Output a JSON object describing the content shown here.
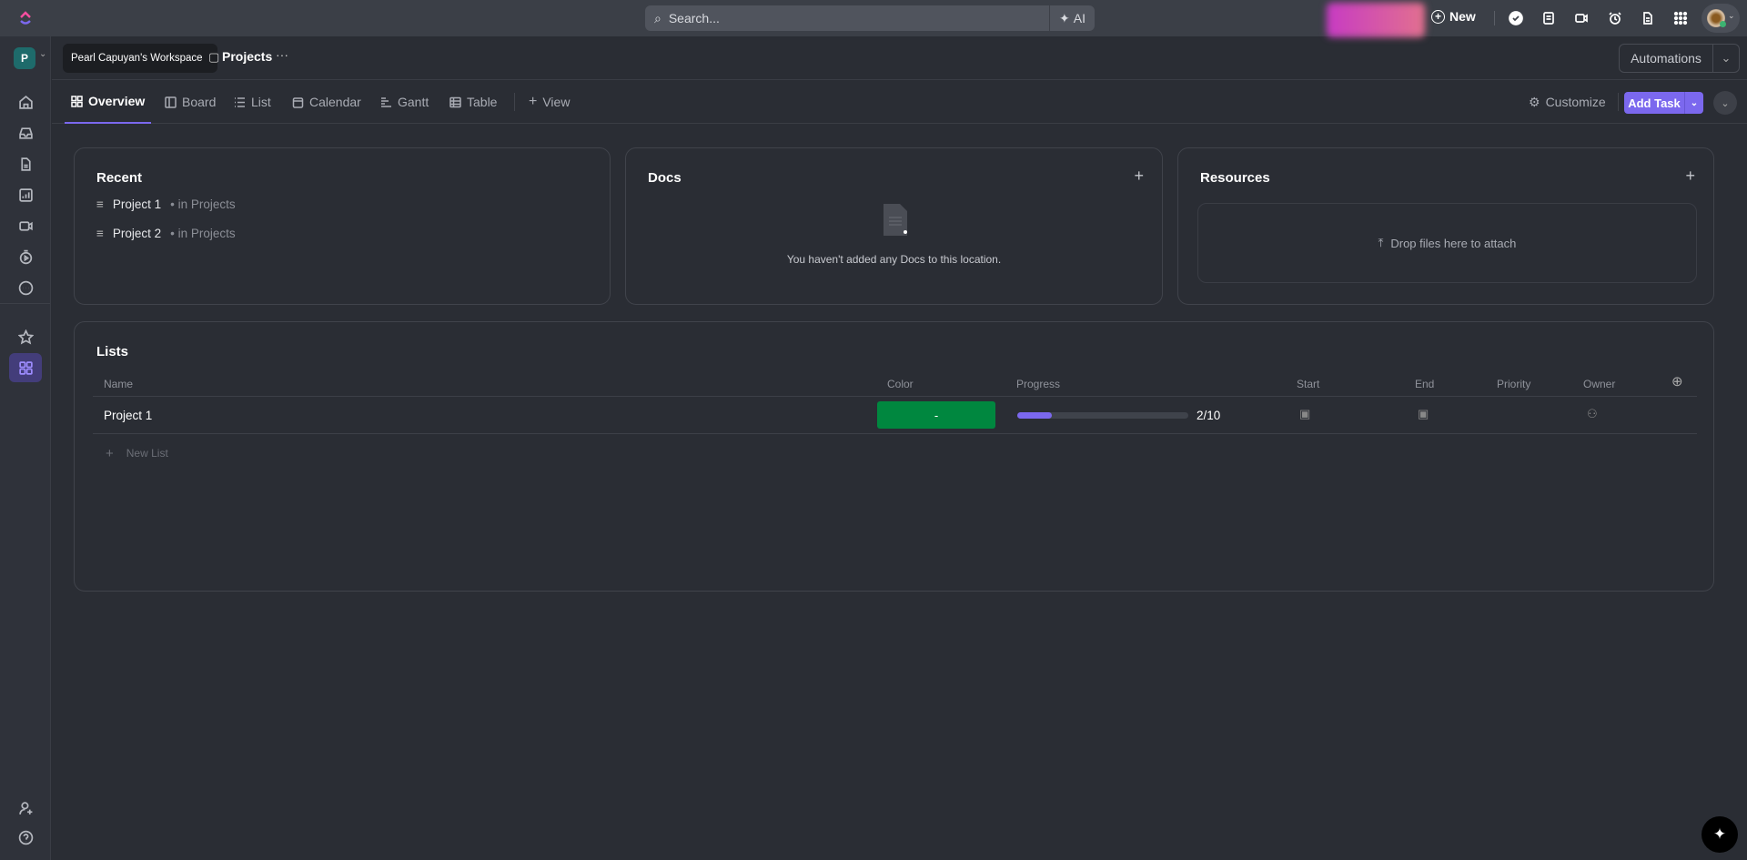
{
  "topbar": {
    "search_placeholder": "Search...",
    "ai_label": "AI",
    "new_label": "New"
  },
  "header": {
    "workspace_initial": "P",
    "tooltip": "Pearl Capuyan's Workspace",
    "breadcrumb_current": "Projects",
    "more": "···",
    "automations_label": "Automations"
  },
  "tabs": [
    {
      "label": "Overview"
    },
    {
      "label": "Board"
    },
    {
      "label": "List"
    },
    {
      "label": "Calendar"
    },
    {
      "label": "Gantt"
    },
    {
      "label": "Table"
    },
    {
      "label": "View"
    }
  ],
  "actions": {
    "customize_label": "Customize",
    "add_task_label": "Add Task"
  },
  "recent": {
    "title": "Recent",
    "items": [
      {
        "name": "Project 1",
        "location": "• in Projects"
      },
      {
        "name": "Project 2",
        "location": "• in Projects"
      }
    ]
  },
  "docs": {
    "title": "Docs",
    "empty_text": "You haven't added any Docs to this location."
  },
  "resources": {
    "title": "Resources",
    "drop_text": "Drop files here to attach"
  },
  "lists": {
    "title": "Lists",
    "columns": [
      "Name",
      "Color",
      "Progress",
      "Start",
      "End",
      "Priority",
      "Owner"
    ],
    "rows": [
      {
        "name": "Project 1",
        "color_label": "-",
        "color": "#00873f",
        "progress_text": "2/10",
        "progress": 0.2
      }
    ],
    "new_list_label": "New List"
  },
  "colors": {
    "accent": "#7b68ee",
    "list_green": "#00873f"
  }
}
